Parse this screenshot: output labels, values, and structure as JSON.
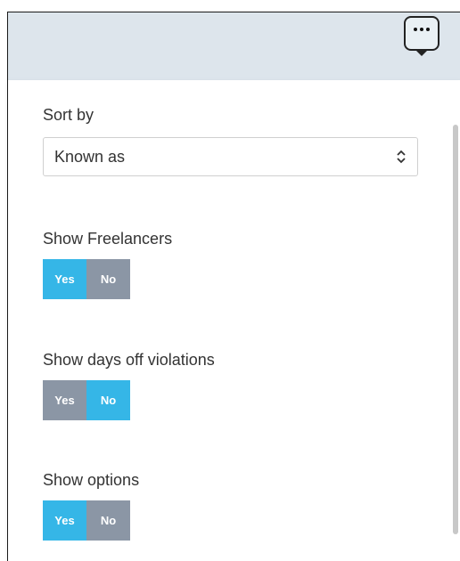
{
  "header": {
    "menu_icon": "more-dots-icon"
  },
  "sort": {
    "label": "Sort by",
    "selected": "Known as",
    "icon": "chevron-up-down-icon"
  },
  "settings": [
    {
      "label": "Show Freelancers",
      "yes": "Yes",
      "no": "No",
      "value": "Yes"
    },
    {
      "label": "Show days off violations",
      "yes": "Yes",
      "no": "No",
      "value": "No"
    },
    {
      "label": "Show options",
      "yes": "Yes",
      "no": "No",
      "value": "Yes"
    }
  ],
  "colors": {
    "active": "#35b6e7",
    "inactive": "#8b96a5",
    "header_bg": "#dde5ec"
  }
}
